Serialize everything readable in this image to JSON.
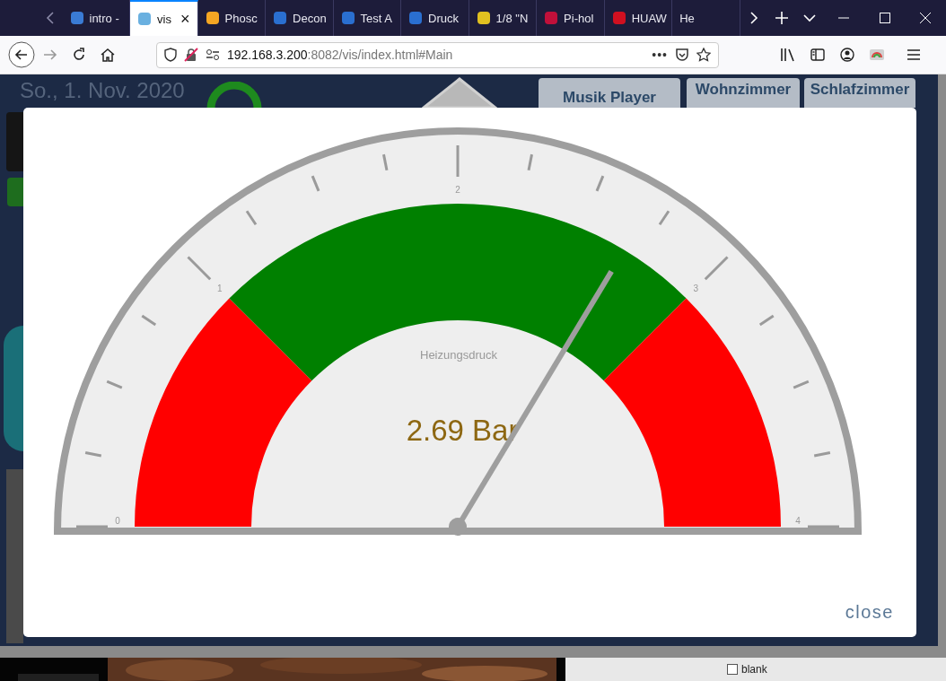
{
  "browser": {
    "tabs": [
      {
        "label": "intro -",
        "selected": false,
        "color": "#3a7bd5"
      },
      {
        "label": "vis",
        "selected": true,
        "color": "#6ab0e0"
      },
      {
        "label": "Phosc",
        "selected": false,
        "color": "#f5a623"
      },
      {
        "label": "Decon",
        "selected": false,
        "color": "#2a6fd0"
      },
      {
        "label": "Test A",
        "selected": false,
        "color": "#2a6fd0"
      },
      {
        "label": "Druck",
        "selected": false,
        "color": "#2a6fd0"
      },
      {
        "label": "1/8 \"N",
        "selected": false,
        "color": "#e0c020"
      },
      {
        "label": "Pi-hol",
        "selected": false,
        "color": "#c0103a"
      },
      {
        "label": "HUAW",
        "selected": false,
        "color": "#d01020"
      },
      {
        "label": "He",
        "selected": false
      }
    ],
    "close_tab": "×",
    "url_host": "192.168.3.200",
    "url_rest": ":8082/vis/index.html#Main",
    "page_actions": "•••"
  },
  "dashboard": {
    "date": "So., 1. Nov. 2020",
    "rooms": [
      {
        "label": "Musik Player"
      },
      {
        "label": "Wohnzimmer"
      },
      {
        "label": "Schlafzimmer"
      }
    ],
    "below_checkbox": {
      "label": "blank",
      "checked": false
    }
  },
  "dialog": {
    "gauge": {
      "title": "Heizungsdruck",
      "value": "2.69 Bar",
      "level": 0.6725,
      "scale": [
        "0",
        "1",
        "2",
        "3",
        "4"
      ],
      "zones": [
        {
          "color": "#ff0000"
        },
        {
          "color": "#008000"
        },
        {
          "color": "#008000"
        },
        {
          "color": "#ff0000"
        }
      ]
    },
    "close": "close"
  }
}
